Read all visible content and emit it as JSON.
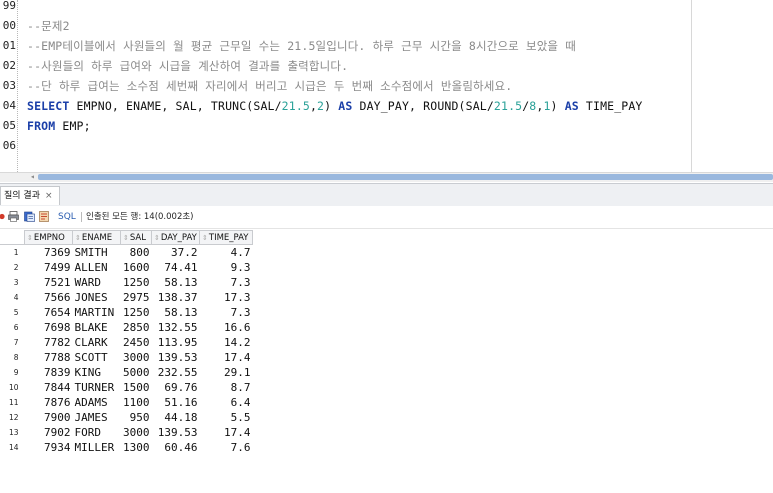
{
  "editor": {
    "line_numbers": [
      "99",
      "00",
      "01",
      "02",
      "03",
      "04",
      "05",
      "06"
    ],
    "lines": [
      {
        "tokens": []
      },
      {
        "tokens": [
          {
            "t": "--문제2",
            "c": "cm"
          }
        ]
      },
      {
        "tokens": [
          {
            "t": "--EMP테이블에서 사원들의 월 평균 근무일 수는 21.5일입니다. 하루 근무 시간을 8시간으로 보았을 때",
            "c": "cm"
          }
        ]
      },
      {
        "tokens": [
          {
            "t": "--사원들의 하루 급여와 시급을 계산하여 결과를 출력합니다.",
            "c": "cm"
          }
        ]
      },
      {
        "tokens": [
          {
            "t": "--단 하루 급여는 소수점 세번째 자리에서 버리고 시급은 두 번째 소수점에서 반올림하세요.",
            "c": "cm"
          }
        ]
      },
      {
        "tokens": [
          {
            "t": "SELECT",
            "c": "kw"
          },
          {
            "t": " EMPNO, ENAME, SAL, TRUNC(SAL/",
            "c": "txt"
          },
          {
            "t": "21.5",
            "c": "num"
          },
          {
            "t": ",",
            "c": "txt"
          },
          {
            "t": "2",
            "c": "num"
          },
          {
            "t": ") ",
            "c": "txt"
          },
          {
            "t": "AS",
            "c": "kw"
          },
          {
            "t": " DAY_PAY, ROUND(SAL/",
            "c": "txt"
          },
          {
            "t": "21.5",
            "c": "num"
          },
          {
            "t": "/",
            "c": "txt"
          },
          {
            "t": "8",
            "c": "num"
          },
          {
            "t": ",",
            "c": "txt"
          },
          {
            "t": "1",
            "c": "num"
          },
          {
            "t": ") ",
            "c": "txt"
          },
          {
            "t": "AS",
            "c": "kw"
          },
          {
            "t": " TIME_PAY",
            "c": "txt"
          }
        ]
      },
      {
        "tokens": [
          {
            "t": "FROM",
            "c": "kw"
          },
          {
            "t": " EMP;",
            "c": "txt"
          }
        ]
      },
      {
        "tokens": []
      }
    ]
  },
  "results_panel": {
    "tab_label": "질의 결과",
    "tab_close": "×",
    "toolbar": {
      "sql_label": "SQL",
      "status": "인출된 모든 행: 14(0.002초)"
    },
    "columns": [
      "EMPNO",
      "ENAME",
      "SAL",
      "DAY_PAY",
      "TIME_PAY"
    ],
    "rows": [
      [
        "1",
        "7369",
        "SMITH",
        "800",
        "37.2",
        "4.7"
      ],
      [
        "2",
        "7499",
        "ALLEN",
        "1600",
        "74.41",
        "9.3"
      ],
      [
        "3",
        "7521",
        "WARD",
        "1250",
        "58.13",
        "7.3"
      ],
      [
        "4",
        "7566",
        "JONES",
        "2975",
        "138.37",
        "17.3"
      ],
      [
        "5",
        "7654",
        "MARTIN",
        "1250",
        "58.13",
        "7.3"
      ],
      [
        "6",
        "7698",
        "BLAKE",
        "2850",
        "132.55",
        "16.6"
      ],
      [
        "7",
        "7782",
        "CLARK",
        "2450",
        "113.95",
        "14.2"
      ],
      [
        "8",
        "7788",
        "SCOTT",
        "3000",
        "139.53",
        "17.4"
      ],
      [
        "9",
        "7839",
        "KING",
        "5000",
        "232.55",
        "29.1"
      ],
      [
        "10",
        "7844",
        "TURNER",
        "1500",
        "69.76",
        "8.7"
      ],
      [
        "11",
        "7876",
        "ADAMS",
        "1100",
        "51.16",
        "6.4"
      ],
      [
        "12",
        "7900",
        "JAMES",
        "950",
        "44.18",
        "5.5"
      ],
      [
        "13",
        "7902",
        "FORD",
        "3000",
        "139.53",
        "17.4"
      ],
      [
        "14",
        "7934",
        "MILLER",
        "1300",
        "60.46",
        "7.6"
      ]
    ]
  },
  "colors": {
    "keyword": "#1b3fa8",
    "comment": "#8a8a8a",
    "number": "#2aa198",
    "scrollbar_thumb": "#9ab8de"
  },
  "icons": [
    "pin-icon",
    "print-icon",
    "export-icon",
    "sql-icon",
    "sort-icon"
  ]
}
